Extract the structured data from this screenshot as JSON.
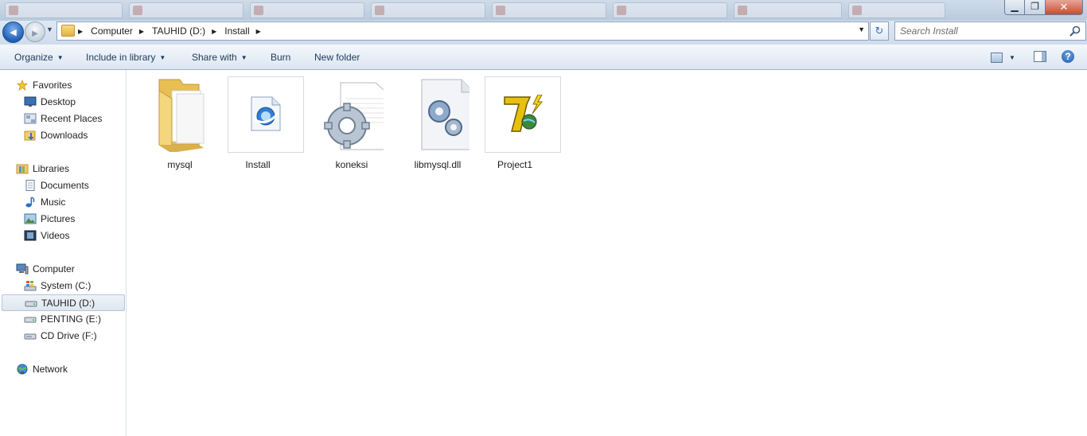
{
  "window": {
    "minimize_glyph": "▁",
    "maximize_glyph": "❐",
    "close_glyph": "✕"
  },
  "navigation": {
    "back_glyph": "◀",
    "forward_glyph": "▶",
    "history_glyph": "▼"
  },
  "address": {
    "crumbs": [
      "Computer",
      "TAUHID (D:)",
      "Install"
    ],
    "separator_glyph": "▶",
    "dropdown_glyph": "▼",
    "refresh_glyph": "↻"
  },
  "search": {
    "placeholder": "Search Install",
    "value": ""
  },
  "toolbar": {
    "organize": "Organize",
    "include_in_library": "Include in library",
    "share_with": "Share with",
    "burn": "Burn",
    "new_folder": "New folder",
    "caret_glyph": "▼",
    "help_glyph": "?"
  },
  "nav_pane": {
    "favorites": {
      "label": "Favorites",
      "items": [
        "Desktop",
        "Recent Places",
        "Downloads"
      ]
    },
    "libraries": {
      "label": "Libraries",
      "items": [
        "Documents",
        "Music",
        "Pictures",
        "Videos"
      ]
    },
    "computer": {
      "label": "Computer",
      "items": [
        "System (C:)",
        "TAUHID (D:)",
        "PENTING (E:)",
        "CD Drive (F:)"
      ],
      "selected": "TAUHID (D:)"
    },
    "network": {
      "label": "Network"
    }
  },
  "files": [
    {
      "name": "mysql",
      "icon": "folder-icon"
    },
    {
      "name": "Install",
      "icon": "setup-icon"
    },
    {
      "name": "koneksi",
      "icon": "config-file-icon"
    },
    {
      "name": "libmysql.dll",
      "icon": "dll-file-icon"
    },
    {
      "name": "Project1",
      "icon": "vb-project-icon"
    }
  ],
  "colors": {
    "accent": "#1f5fb5",
    "selection_border": "#b6c5d6",
    "folder_yellow": "#f0cd6a"
  }
}
